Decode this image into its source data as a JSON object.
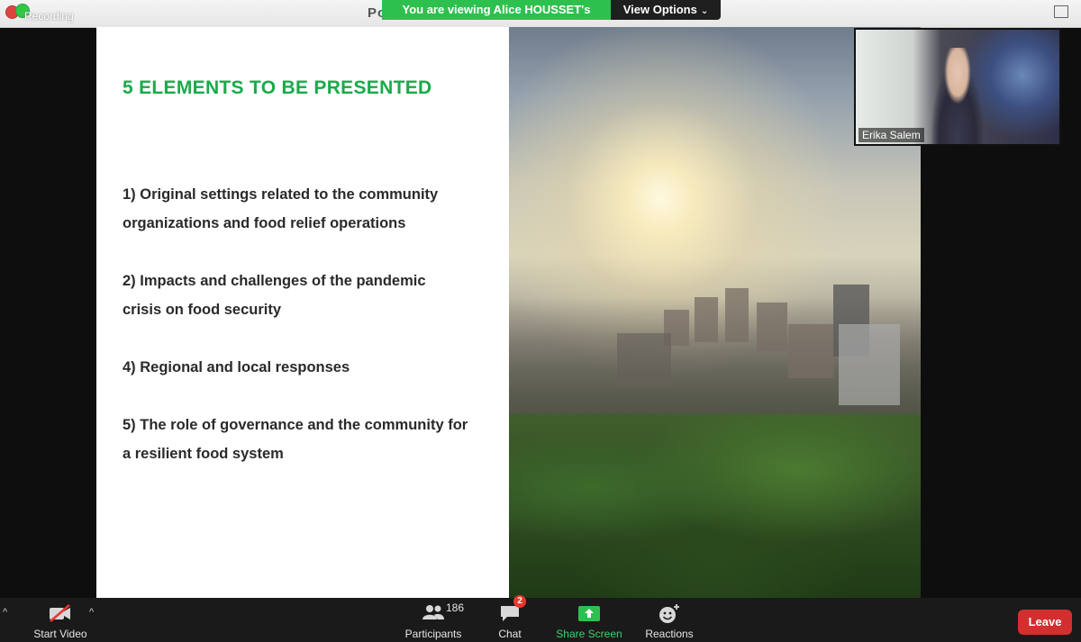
{
  "window": {
    "title_fragment": "Po",
    "recording_label": "Recording",
    "viewing_banner": "You are viewing Alice HOUSSET's screen",
    "view_options_label": "View Options"
  },
  "slide": {
    "title": "5 ELEMENTS TO BE PRESENTED",
    "items": [
      {
        "line1": "1) Original settings related to the community",
        "line2": "organizations and food relief operations"
      },
      {
        "line1": "2) Impacts and challenges of the pandemic",
        "line2": "crisis on food security"
      },
      {
        "line1": "4) Regional and local responses",
        "line2": ""
      },
      {
        "line1": "5) The role of governance and the community for",
        "line2": "a resilient food system"
      }
    ]
  },
  "participant_video": {
    "name": "Erika Salem"
  },
  "toolbar": {
    "start_video_label": "Start Video",
    "participants_label": "Participants",
    "participants_count": "186",
    "chat_label": "Chat",
    "chat_badge": "2",
    "share_screen_label": "Share Screen",
    "reactions_label": "Reactions",
    "leave_label": "Leave"
  },
  "colors": {
    "banner_green": "#2ec04e",
    "slide_title_green": "#1aaa4a",
    "leave_red": "#d32f2f",
    "share_green": "#3bd16f",
    "toolbar_bg": "#1a1a1a"
  }
}
